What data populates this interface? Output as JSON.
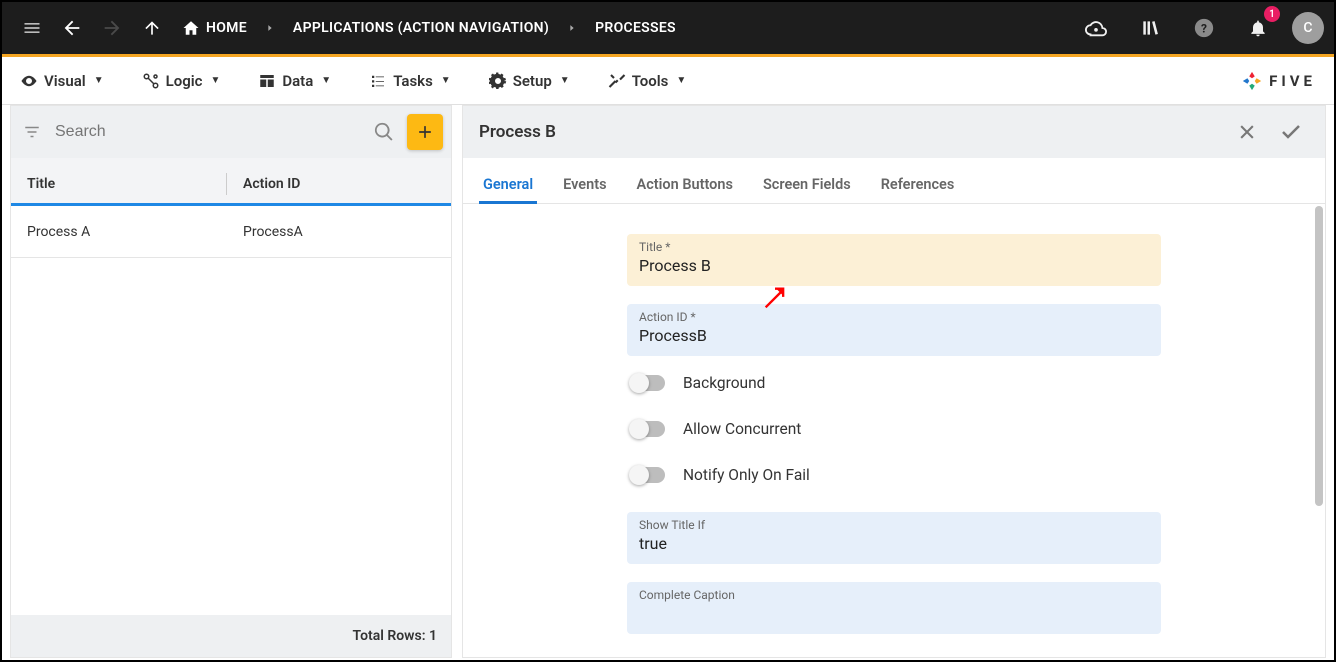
{
  "header": {
    "home_label": "HOME",
    "breadcrumb1": "APPLICATIONS (ACTION NAVIGATION)",
    "breadcrumb2": "PROCESSES",
    "notification_count": "1",
    "avatar_letter": "C"
  },
  "menubar": {
    "visual": "Visual",
    "logic": "Logic",
    "data": "Data",
    "tasks": "Tasks",
    "setup": "Setup",
    "tools": "Tools",
    "brand": "FIVE"
  },
  "left": {
    "search_placeholder": "Search",
    "col_title": "Title",
    "col_action_id": "Action ID",
    "rows": [
      {
        "title": "Process A",
        "action_id": "ProcessA"
      }
    ],
    "footer_label": "Total Rows:",
    "footer_count": "1"
  },
  "detail": {
    "title": "Process B",
    "tabs": {
      "general": "General",
      "events": "Events",
      "action_buttons": "Action Buttons",
      "screen_fields": "Screen Fields",
      "references": "References"
    },
    "fields": {
      "title_label": "Title *",
      "title_value": "Process B",
      "action_id_label": "Action ID *",
      "action_id_value": "ProcessB",
      "background_label": "Background",
      "allow_concurrent_label": "Allow Concurrent",
      "notify_only_on_fail_label": "Notify Only On Fail",
      "show_title_if_label": "Show Title If",
      "show_title_if_value": "true",
      "complete_caption_label": "Complete Caption"
    }
  }
}
